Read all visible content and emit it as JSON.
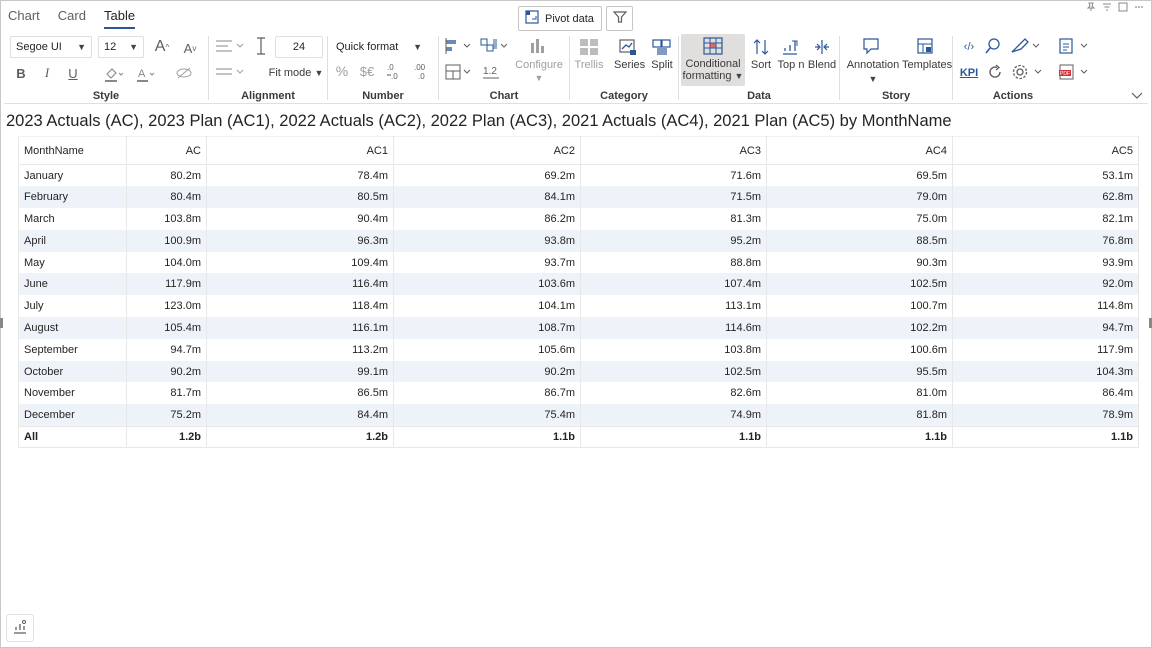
{
  "tabs": [
    {
      "label": "Chart"
    },
    {
      "label": "Card"
    },
    {
      "label": "Table"
    }
  ],
  "active_tab": "Table",
  "toolbar": {
    "pivot_label": "Pivot data"
  },
  "ribbon": {
    "style": {
      "label": "Style",
      "font_family": "Segoe UI",
      "font_size": "12"
    },
    "alignment": {
      "label": "Alignment",
      "row_height": "24",
      "fit_mode": "Fit mode"
    },
    "number": {
      "label": "Number",
      "quick_format": "Quick format",
      "decimal_sample": "1.2"
    },
    "chart": {
      "label": "Chart",
      "configure": "Configure"
    },
    "category": {
      "label": "Category",
      "trellis": "Trellis",
      "series": "Series",
      "split": "Split"
    },
    "data": {
      "label": "Data",
      "conditional_line1": "Conditional",
      "conditional_line2": "formatting",
      "sort": "Sort",
      "topn": "Top n",
      "blend": "Blend"
    },
    "story": {
      "label": "Story",
      "annotation": "Annotation",
      "templates": "Templates"
    },
    "actions": {
      "label": "Actions",
      "kpi": "KPI"
    }
  },
  "visual_title": "2023 Actuals (AC), 2023 Plan (AC1), 2022 Actuals (AC2), 2022 Plan (AC3), 2021 Actuals (AC4), 2021 Plan (AC5) by MonthName",
  "table": {
    "headers": [
      "MonthName",
      "AC",
      "AC1",
      "AC2",
      "AC3",
      "AC4",
      "AC5"
    ],
    "rows": [
      [
        "January",
        "80.2m",
        "78.4m",
        "69.2m",
        "71.6m",
        "69.5m",
        "53.1m"
      ],
      [
        "February",
        "80.4m",
        "80.5m",
        "84.1m",
        "71.5m",
        "79.0m",
        "62.8m"
      ],
      [
        "March",
        "103.8m",
        "90.4m",
        "86.2m",
        "81.3m",
        "75.0m",
        "82.1m"
      ],
      [
        "April",
        "100.9m",
        "96.3m",
        "93.8m",
        "95.2m",
        "88.5m",
        "76.8m"
      ],
      [
        "May",
        "104.0m",
        "109.4m",
        "93.7m",
        "88.8m",
        "90.3m",
        "93.9m"
      ],
      [
        "June",
        "117.9m",
        "116.4m",
        "103.6m",
        "107.4m",
        "102.5m",
        "92.0m"
      ],
      [
        "July",
        "123.0m",
        "118.4m",
        "104.1m",
        "113.1m",
        "100.7m",
        "114.8m"
      ],
      [
        "August",
        "105.4m",
        "116.1m",
        "108.7m",
        "114.6m",
        "102.2m",
        "94.7m"
      ],
      [
        "September",
        "94.7m",
        "113.2m",
        "105.6m",
        "103.8m",
        "100.6m",
        "117.9m"
      ],
      [
        "October",
        "90.2m",
        "99.1m",
        "90.2m",
        "102.5m",
        "95.5m",
        "104.3m"
      ],
      [
        "November",
        "81.7m",
        "86.5m",
        "86.7m",
        "82.6m",
        "81.0m",
        "86.4m"
      ],
      [
        "December",
        "75.2m",
        "84.4m",
        "75.4m",
        "74.9m",
        "81.8m",
        "78.9m"
      ]
    ],
    "total": [
      "All",
      "1.2b",
      "1.2b",
      "1.1b",
      "1.1b",
      "1.1b",
      "1.1b"
    ]
  },
  "colors": {
    "accent": "#2b579a",
    "row_alt": "#eef3fa",
    "selected_button": "#e1dfdd",
    "pdf_red": "#d13438"
  }
}
